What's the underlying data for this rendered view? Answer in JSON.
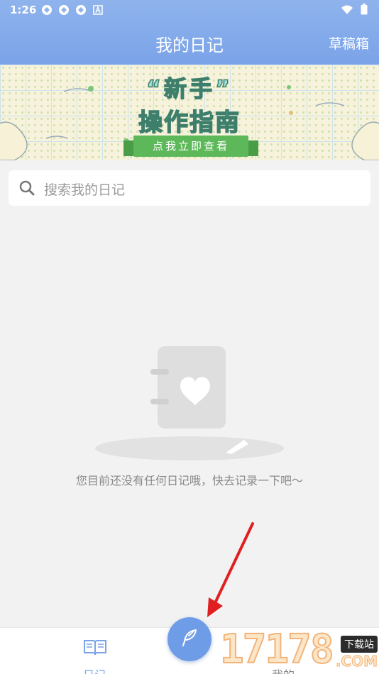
{
  "status_bar": {
    "time": "1:26",
    "notification_icons": [
      "sync-icon",
      "sync-icon",
      "sync-icon",
      "text-a-icon"
    ],
    "right_icons": [
      "wifi-icon",
      "battery-icon"
    ]
  },
  "header": {
    "title": "我的日记",
    "drafts_label": "草稿箱"
  },
  "banner": {
    "title_line1": "“新手”",
    "title_line2": "操作指南",
    "ribbon_text": "点我立即查看"
  },
  "search": {
    "placeholder": "搜索我的日记"
  },
  "empty_state": {
    "message": "您目前还没有任何日记哦，快去记录一下吧～"
  },
  "tabs": [
    {
      "label": "日记",
      "icon": "book-icon",
      "active": true
    },
    {
      "label": "我的",
      "active": false
    }
  ],
  "fab": {
    "icon": "feather-pen-icon"
  },
  "watermark": {
    "number": "17178",
    "site": "下载站",
    "suffix": ".COM"
  },
  "colors": {
    "accent": "#7aa3e8",
    "background": "#f2f2f2",
    "annotation_arrow": "#e02020"
  }
}
